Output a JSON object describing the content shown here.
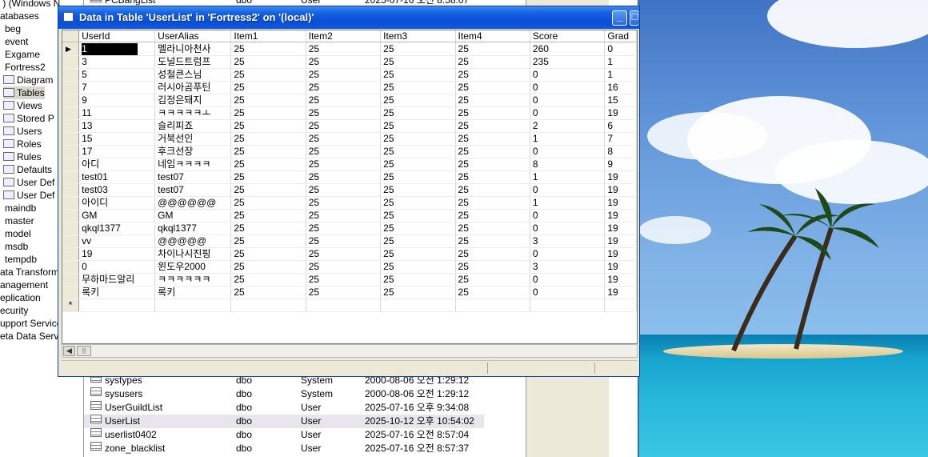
{
  "tree": [
    " ) (Windows N",
    "atabases",
    "beg",
    "event",
    "Exgame",
    "Fortress2",
    "Diagram",
    "Tables",
    "Views",
    "Stored P",
    "Users",
    "Roles",
    "Rules",
    "Defaults",
    "User Def",
    "User Def",
    "maindb",
    "master",
    "model",
    "msdb",
    "tempdb",
    "ata Transform",
    "anagement",
    "eplication",
    "ecurity",
    "upport Service",
    "eta Data Serv"
  ],
  "list_pane": {
    "rows": [
      {
        "name": "PCBangList",
        "owner": "dbo",
        "type": "User",
        "created": "2025-07-16 오전 8:58:07"
      },
      {
        "name": "systypes",
        "owner": "dbo",
        "type": "System",
        "created": "2000-08-06 오전 1:29:12"
      },
      {
        "name": "sysusers",
        "owner": "dbo",
        "type": "System",
        "created": "2000-08-06 오전 1:29:12"
      },
      {
        "name": "UserGuildList",
        "owner": "dbo",
        "type": "User",
        "created": "2025-07-16 오후 9:34:08"
      },
      {
        "name": "UserList",
        "owner": "dbo",
        "type": "User",
        "created": "2025-10-12 오후 10:54:02"
      },
      {
        "name": "userlist0402",
        "owner": "dbo",
        "type": "User",
        "created": "2025-07-16 오전 8:57:04"
      },
      {
        "name": "zone_blacklist",
        "owner": "dbo",
        "type": "User",
        "created": "2025-07-16 오전 8:57:37"
      }
    ]
  },
  "window": {
    "title": "Data in Table 'UserList' in 'Fortress2' on '(local)'",
    "minimize": "_",
    "maximize": "□"
  },
  "grid": {
    "columns": [
      "UserId",
      "UserAlias",
      "Item1",
      "Item2",
      "Item3",
      "Item4",
      "Score",
      "Grad"
    ],
    "rows": [
      [
        "1",
        "멜라니아천사",
        "25",
        "25",
        "25",
        "25",
        "260",
        "0"
      ],
      [
        "3",
        "도널드트럼프",
        "25",
        "25",
        "25",
        "25",
        "235",
        "1"
      ],
      [
        "5",
        "성철큰스님",
        "25",
        "25",
        "25",
        "25",
        "0",
        "1"
      ],
      [
        "7",
        "러시아곰푸틴",
        "25",
        "25",
        "25",
        "25",
        "0",
        "16"
      ],
      [
        "9",
        "김정은돼지",
        "25",
        "25",
        "25",
        "25",
        "0",
        "15"
      ],
      [
        "11",
        "ㅋㅋㅋㅋㅋㅗ",
        "25",
        "25",
        "25",
        "25",
        "0",
        "19"
      ],
      [
        "13",
        "슬리피죠",
        "25",
        "25",
        "25",
        "25",
        "2",
        "6"
      ],
      [
        "15",
        "거북선인",
        "25",
        "25",
        "25",
        "25",
        "1",
        "7"
      ],
      [
        "17",
        "후크선장",
        "25",
        "25",
        "25",
        "25",
        "0",
        "8"
      ],
      [
        "아디",
        "네임ㅋㅋㅋㅋ",
        "25",
        "25",
        "25",
        "25",
        "8",
        "9"
      ],
      [
        "test01",
        "test07",
        "25",
        "25",
        "25",
        "25",
        "1",
        "19"
      ],
      [
        "test03",
        "test07",
        "25",
        "25",
        "25",
        "25",
        "0",
        "19"
      ],
      [
        "아이디",
        "@@@@@@",
        "25",
        "25",
        "25",
        "25",
        "1",
        "19"
      ],
      [
        "GM",
        "GM",
        "25",
        "25",
        "25",
        "25",
        "0",
        "19"
      ],
      [
        "qkql1377",
        "qkql1377",
        "25",
        "25",
        "25",
        "25",
        "0",
        "19"
      ],
      [
        "vv",
        "@@@@@",
        "25",
        "25",
        "25",
        "25",
        "3",
        "19"
      ],
      [
        "19",
        "차이나시진핑",
        "25",
        "25",
        "25",
        "25",
        "0",
        "19"
      ],
      [
        "0",
        "윈도우2000",
        "25",
        "25",
        "25",
        "25",
        "3",
        "19"
      ],
      [
        "무하마드알리",
        "ㅋㅋㅋㅋㅋㅋ",
        "25",
        "25",
        "25",
        "25",
        "0",
        "19"
      ],
      [
        "록키",
        "록키",
        "25",
        "25",
        "25",
        "25",
        "0",
        "19"
      ]
    ],
    "new_row_marker": "*",
    "current_row_marker": "▶"
  }
}
